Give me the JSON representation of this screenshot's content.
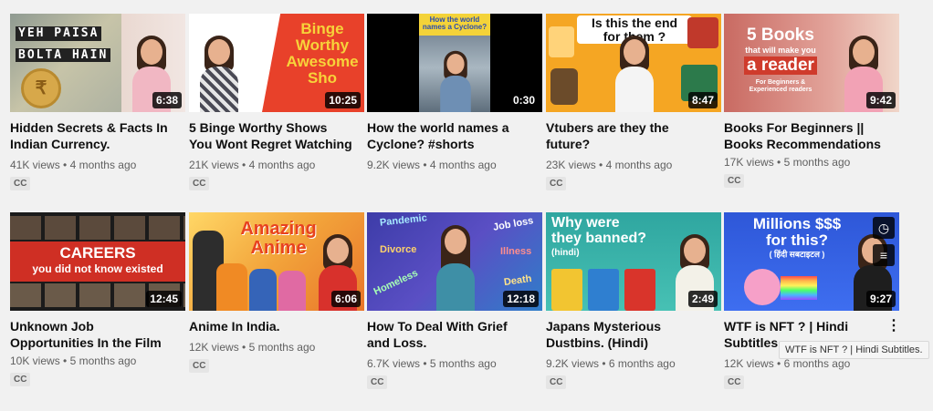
{
  "videos": [
    {
      "title": "Hidden Secrets & Facts In Indian Currency.",
      "views": "41K views",
      "age": "4 months ago",
      "duration": "6:38",
      "cc": "CC",
      "thumb_text": "YEH PAISA\nBOLTA HAIN"
    },
    {
      "title": "5 Binge Worthy Shows You Wont Regret Watching",
      "views": "21K views",
      "age": "4 months ago",
      "duration": "10:25",
      "cc": "CC",
      "thumb_text": "Binge\nWorthy\nAwesome\nSho"
    },
    {
      "title": "How the world names a Cyclone? #shorts",
      "views": "9.2K views",
      "age": "4 months ago",
      "duration": "0:30",
      "cc": "",
      "thumb_text": "How the world\nnames a Cyclone?"
    },
    {
      "title": "Vtubers are they the future?",
      "views": "23K views",
      "age": "4 months ago",
      "duration": "8:47",
      "cc": "CC",
      "thumb_text": "Is this the end\nfor them ?"
    },
    {
      "title": "Books For Beginners || Books Recommendations t…",
      "views": "17K views",
      "age": "5 months ago",
      "duration": "9:42",
      "cc": "CC",
      "thumb_text": "5 Books\nthat will make you\na reader",
      "thumb_sub": "For Beginners &\nExperienced readers"
    },
    {
      "title": "Unknown Job Opportunities In the Film Industry - Who…",
      "views": "10K views",
      "age": "5 months ago",
      "duration": "12:45",
      "cc": "CC",
      "thumb_text": "CAREERS\nyou did not know existed"
    },
    {
      "title": "Anime In India.",
      "views": "12K views",
      "age": "5 months ago",
      "duration": "6:06",
      "cc": "CC",
      "thumb_text": "Amazing\nAnime"
    },
    {
      "title": "How To Deal With Grief and Loss.",
      "views": "6.7K views",
      "age": "5 months ago",
      "duration": "12:18",
      "cc": "CC",
      "thumb_words": [
        "Pandemic",
        "Job loss",
        "Divorce",
        "Illness",
        "Homeless",
        "Death"
      ]
    },
    {
      "title": "Japans Mysterious Dustbins. (Hindi)",
      "views": "9.2K views",
      "age": "6 months ago",
      "duration": "2:49",
      "cc": "CC",
      "thumb_text": "Why were\nthey banned?",
      "thumb_sub": "(hindi)"
    },
    {
      "title": "WTF is NFT ? | Hindi Subtitles.",
      "views": "12K views",
      "age": "6 months ago",
      "duration": "9:27",
      "cc": "CC",
      "thumb_text": "Millions $$$\nfor this?",
      "thumb_sub": "( हिंदी सबटाइटल )"
    }
  ],
  "separator": "•",
  "tooltip": "WTF is NFT ? | Hindi Subtitles.",
  "icons": {
    "watch_later": "clock-icon",
    "add_queue": "queue-icon",
    "menu": "kebab-menu-icon"
  }
}
